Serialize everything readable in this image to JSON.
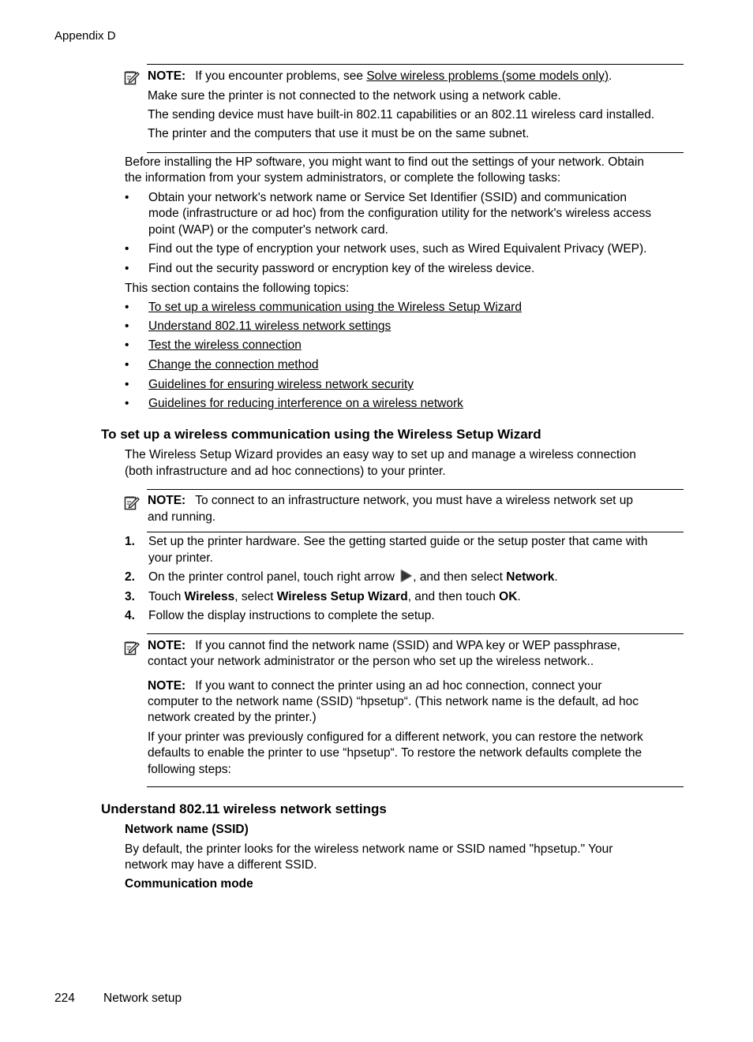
{
  "header": {
    "running_head": "Appendix D"
  },
  "footer": {
    "page_number": "224",
    "section_title": "Network setup"
  },
  "note1": {
    "label": "NOTE:",
    "text_before_link": "If you encounter problems, see ",
    "link": "Solve wireless problems (some models only)",
    "text_after_link": ".",
    "lines": [
      "Make sure the printer is not connected to the network using a network cable.",
      "The sending device must have built-in 802.11 capabilities or an 802.11 wireless card installed.",
      "The printer and the computers that use it must be on the same subnet."
    ]
  },
  "intro": {
    "lines": [
      "Before installing the HP software, you might want to find out the settings of your network. Obtain",
      "the information from your system administrators, or complete the following tasks:"
    ],
    "tasks": [
      {
        "lines": [
          "Obtain your network's network name or Service Set Identifier (SSID) and communication",
          "mode (infrastructure or ad hoc) from the configuration utility for the network's wireless access",
          "point (WAP) or the computer's network card."
        ]
      },
      {
        "lines": [
          "Find out the type of encryption your network uses, such as Wired Equivalent Privacy (WEP)."
        ]
      },
      {
        "lines": [
          "Find out the security password or encryption key of the wireless device."
        ]
      }
    ],
    "topics_intro": "This section contains the following topics:",
    "topics": [
      "To set up a wireless communication using the Wireless Setup Wizard",
      "Understand 802.11 wireless network settings",
      "Test the wireless connection",
      "Change the connection method",
      "Guidelines for ensuring wireless network security",
      "Guidelines for reducing interference on a wireless network"
    ],
    "bullet": "•"
  },
  "section_wizard": {
    "heading": "To set up a wireless communication using the Wireless Setup Wizard",
    "lines": [
      "The Wireless Setup Wizard provides an easy way to set up and manage a wireless connection",
      "(both infrastructure and ad hoc connections) to your printer."
    ],
    "note": {
      "label": "NOTE:",
      "line1": "To connect to an infrastructure network, you must have a wireless network set up",
      "line2": "and running."
    },
    "steps": [
      {
        "num": "1.",
        "line1": "Set up the printer hardware. See the getting started guide or the setup poster that came with",
        "line2": "your printer."
      },
      {
        "num": "2.",
        "before_icon": "On the printer control panel, touch right arrow ",
        "icon": "right-arrow-icon",
        "after_icon": ", and then select ",
        "bold": "Network",
        "end": "."
      },
      {
        "num": "3.",
        "t1": "Touch ",
        "b1": "Wireless",
        "t2": ", select ",
        "b2": "Wireless Setup Wizard",
        "t3": ", and then touch ",
        "b3": "OK",
        "t4": "."
      },
      {
        "num": "4.",
        "line1": "Follow the display instructions to complete the setup."
      }
    ],
    "note2": {
      "label": "NOTE:",
      "line1": "If you cannot find the network name (SSID) and WPA key or WEP passphrase,",
      "line2": "contact your network administrator or the person who set up the wireless network.."
    },
    "note3": {
      "label": "NOTE:",
      "line1": "If you want to connect the printer using an ad hoc connection, connect your",
      "line2": "computer to the network name (SSID) “hpsetup“. (This network name is the default, ad hoc",
      "line3": "network created by the printer.)"
    },
    "restore": [
      "If your printer was previously configured for a different network, you can restore the network",
      "defaults to enable the printer to use “hpsetup“. To restore the network defaults complete the",
      "following steps:"
    ]
  },
  "section_settings": {
    "heading": "Understand 802.11 wireless network settings",
    "sub1": "Network name (SSID)",
    "sub1_lines": [
      "By default, the printer looks for the wireless network name or SSID named \"hpsetup.\" Your",
      "network may have a different SSID."
    ],
    "sub2": "Communication mode"
  }
}
